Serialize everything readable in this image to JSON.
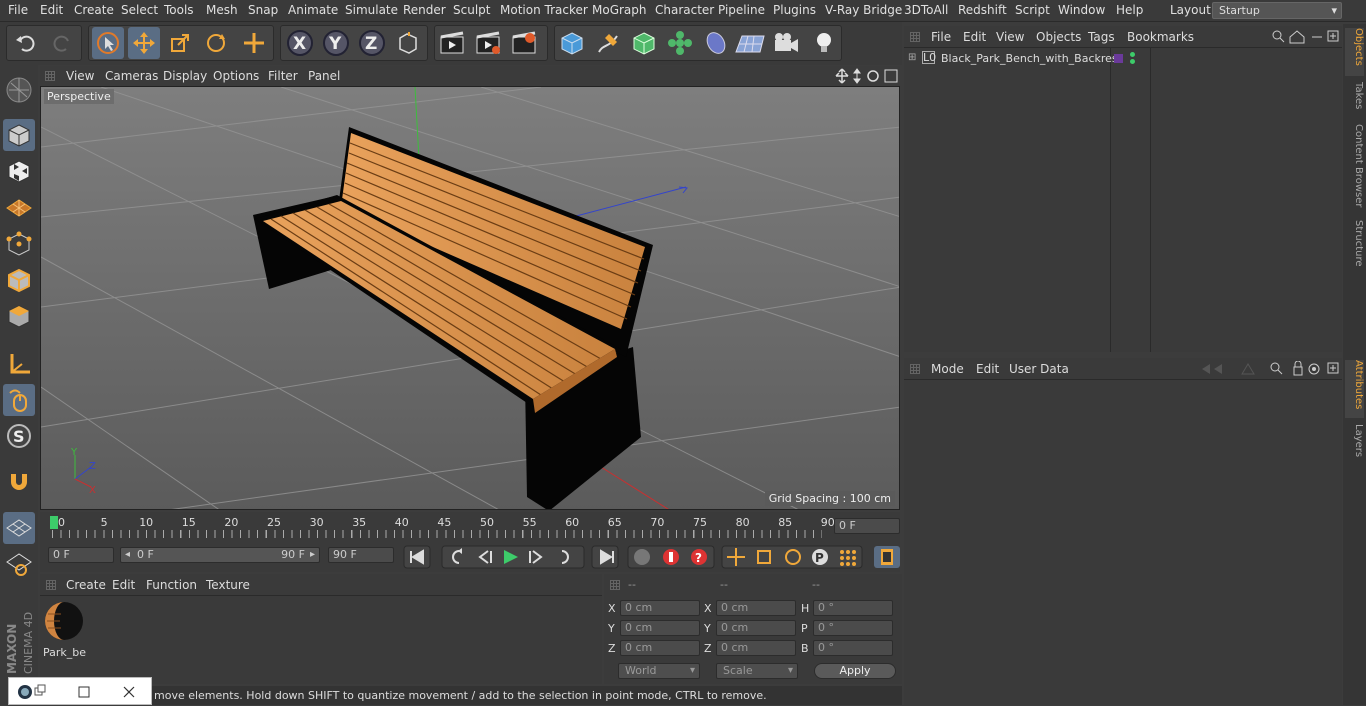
{
  "menubar": {
    "items": [
      "File",
      "Edit",
      "Create",
      "Select",
      "Tools",
      "Mesh",
      "Snap",
      "Animate",
      "Simulate",
      "Render",
      "Sculpt",
      "Motion Tracker",
      "MoGraph",
      "Character",
      "Pipeline",
      "Plugins",
      "V-Ray Bridge",
      "3DToAll",
      "Redshift",
      "Script",
      "Window",
      "Help"
    ],
    "layout_label": "Layout:",
    "layout_value": "Startup"
  },
  "toolbar": {
    "icons": [
      "undo-icon",
      "redo-icon",
      "live-select-icon",
      "move-icon",
      "scale-icon",
      "rotate-icon",
      "transform-icon",
      "x-axis-icon",
      "y-axis-icon",
      "z-axis-icon",
      "coordinate-system-icon",
      "render-view-icon",
      "render-picture-viewer-icon",
      "render-settings-icon",
      "cube-icon",
      "pen-icon",
      "subdivision-icon",
      "cloner-icon",
      "deformer-icon",
      "floor-icon",
      "camera-icon",
      "light-icon"
    ]
  },
  "leftbar": {
    "icons": [
      "make-editable-icon",
      "model-mode-icon",
      "texture-mode-icon",
      "workplane-icon",
      "points-mode-icon",
      "edges-mode-icon",
      "polygons-mode-icon",
      "axis-icon",
      "tweak-icon",
      "solo-icon",
      "magnet-icon",
      "snap-icon",
      "snap-settings-icon"
    ]
  },
  "viewport": {
    "menu": [
      "View",
      "Cameras",
      "Display",
      "Options",
      "Filter",
      "Panel"
    ],
    "label": "Perspective",
    "grid_spacing": "Grid Spacing : 100 cm"
  },
  "timeline": {
    "ticks": [
      "0",
      "5",
      "10",
      "15",
      "20",
      "25",
      "30",
      "35",
      "40",
      "45",
      "50",
      "55",
      "60",
      "65",
      "70",
      "75",
      "80",
      "85",
      "90"
    ],
    "current_frame": "0 F"
  },
  "controls": {
    "start_frame": "0 F",
    "range_start": "0 F",
    "range_end": "90 F",
    "end_frame": "90 F"
  },
  "materials": {
    "menu": [
      "Create",
      "Edit",
      "Function",
      "Texture"
    ],
    "items": [
      {
        "name": "Park_be"
      }
    ]
  },
  "coordinates": {
    "headers": [
      "--",
      "--",
      "--"
    ],
    "rows": [
      {
        "l1": "X",
        "v1": "0 cm",
        "l2": "X",
        "v2": "0 cm",
        "l3": "H",
        "v3": "0 °"
      },
      {
        "l1": "Y",
        "v1": "0 cm",
        "l2": "Y",
        "v2": "0 cm",
        "l3": "P",
        "v3": "0 °"
      },
      {
        "l1": "Z",
        "v1": "0 cm",
        "l2": "Z",
        "v2": "0 cm",
        "l3": "B",
        "v3": "0 °"
      }
    ],
    "mode_world": "World",
    "mode_scale": "Scale",
    "apply_label": "Apply"
  },
  "status": {
    "text": "move elements. Hold down SHIFT to quantize movement / add to the selection in point mode, CTRL to remove."
  },
  "objects": {
    "menu": [
      "File",
      "Edit",
      "View",
      "Objects",
      "Tags",
      "Bookmarks"
    ],
    "items": [
      {
        "name": "Black_Park_Bench_with_Backrest"
      }
    ]
  },
  "attributes": {
    "menu": [
      "Mode",
      "Edit",
      "User Data"
    ]
  },
  "sidetabs": [
    "Objects",
    "Takes",
    "Content Browser",
    "Structure",
    "Attributes",
    "Layers"
  ],
  "brand": {
    "maxon": "MAXON",
    "cinema": "CINEMA 4D"
  }
}
